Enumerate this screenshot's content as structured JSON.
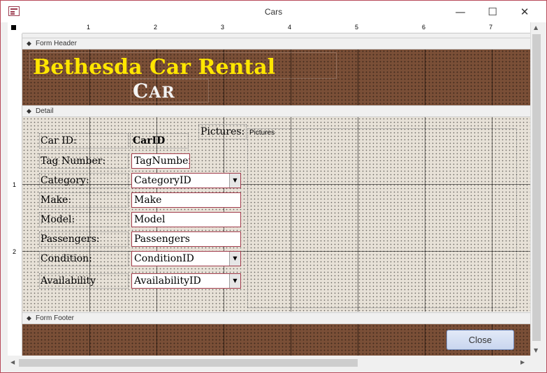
{
  "window": {
    "title": "Cars"
  },
  "titlebar_buttons": {
    "minimize": "—",
    "maximize": "☐",
    "close": "✕"
  },
  "ruler": {
    "h_marks": [
      "1",
      "2",
      "3",
      "4",
      "5",
      "6",
      "7"
    ],
    "v_marks": [
      "1",
      "2"
    ]
  },
  "sections": {
    "header": "Form Header",
    "detail": "Detail",
    "footer": "Form Footer"
  },
  "header": {
    "title": "Bethesda Car Rental",
    "subtitle_first": "C",
    "subtitle_rest": "AR"
  },
  "fields": [
    {
      "label": "Car ID:",
      "value": "CarID",
      "kind": "bound-text"
    },
    {
      "label": "Tag Number:",
      "value": "TagNumber",
      "kind": "textbox"
    },
    {
      "label": "Category:",
      "value": "CategoryID",
      "kind": "combo"
    },
    {
      "label": "Make:",
      "value": "Make",
      "kind": "textbox"
    },
    {
      "label": "Model:",
      "value": "Model",
      "kind": "textbox"
    },
    {
      "label": "Passengers:",
      "value": "Passengers",
      "kind": "textbox"
    },
    {
      "label": "Condition:",
      "value": "ConditionID",
      "kind": "combo"
    },
    {
      "label": "Availability",
      "value": "AvailabilityID",
      "kind": "combo"
    }
  ],
  "pictures": {
    "label": "Pictures:",
    "control": "Pictures"
  },
  "footer": {
    "close_label": "Close"
  },
  "colors": {
    "header_band": "#7a4f37",
    "title_color": "#ffe600",
    "detail_band": "#e7e1d7",
    "field_border": "#a13b4b"
  }
}
